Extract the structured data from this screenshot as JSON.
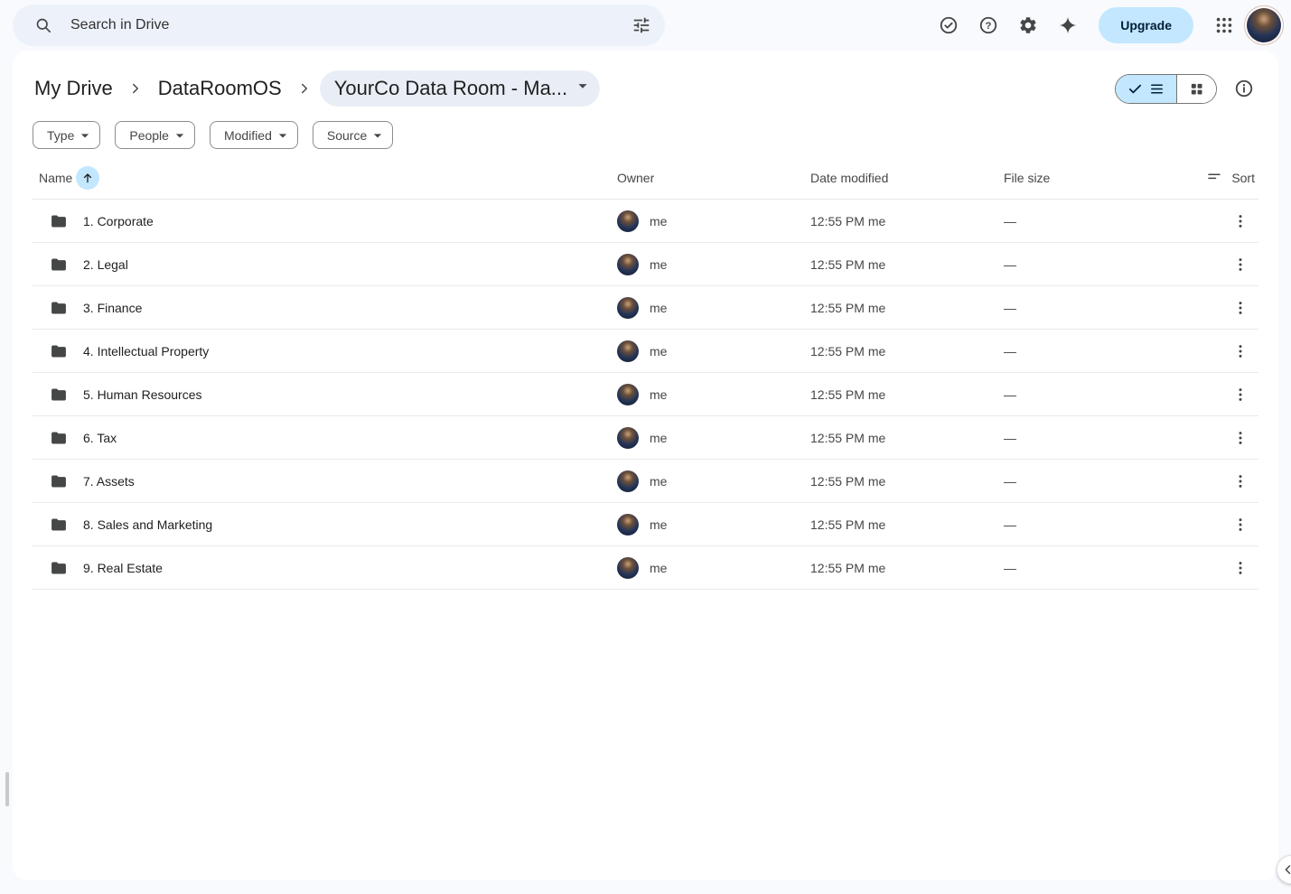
{
  "topbar": {
    "search_placeholder": "Search in Drive",
    "upgrade_label": "Upgrade"
  },
  "breadcrumb": {
    "items": [
      "My Drive",
      "DataRoomOS",
      "YourCo Data Room - Ma..."
    ]
  },
  "filters": [
    "Type",
    "People",
    "Modified",
    "Source"
  ],
  "table": {
    "headers": {
      "name": "Name",
      "owner": "Owner",
      "modified": "Date modified",
      "size": "File size",
      "sort": "Sort"
    },
    "rows": [
      {
        "name": "1. Corporate",
        "owner": "me",
        "modified": "12:55 PM me",
        "size": "—"
      },
      {
        "name": "2. Legal",
        "owner": "me",
        "modified": "12:55 PM me",
        "size": "—"
      },
      {
        "name": "3. Finance",
        "owner": "me",
        "modified": "12:55 PM me",
        "size": "—"
      },
      {
        "name": "4. Intellectual Property",
        "owner": "me",
        "modified": "12:55 PM me",
        "size": "—"
      },
      {
        "name": "5. Human Resources",
        "owner": "me",
        "modified": "12:55 PM me",
        "size": "—"
      },
      {
        "name": "6. Tax",
        "owner": "me",
        "modified": "12:55 PM me",
        "size": "—"
      },
      {
        "name": "7. Assets",
        "owner": "me",
        "modified": "12:55 PM me",
        "size": "—"
      },
      {
        "name": "8. Sales and Marketing",
        "owner": "me",
        "modified": "12:55 PM me",
        "size": "—"
      },
      {
        "name": "9. Real Estate",
        "owner": "me",
        "modified": "12:55 PM me",
        "size": "—"
      }
    ]
  },
  "icons": {
    "search": "magnifier",
    "tune": "filter-sliders",
    "offline-status": "check-circle",
    "help": "question-circle",
    "settings": "gear",
    "gemini": "four-point-sparkle",
    "apps": "3x3-dot-grid",
    "list-view": "check + list lines",
    "grid-view": "2x2 squares",
    "info": "i-circle",
    "name-sort": "arrow-up in blue circle",
    "sort": "descending lines",
    "folder": "filled folder",
    "row-menu": "vertical 3 dots",
    "side-peek": "chevron-left"
  },
  "colors": {
    "chrome_bg": "#f8fafd",
    "surface": "#ffffff",
    "search_bg": "#edf2fa",
    "accent_blue": "#c2e7ff",
    "accent_text": "#001d35",
    "crumb_pill_bg": "#e9eef6",
    "divider": "#e7eaee",
    "text_primary": "#1f1f1f",
    "text_secondary": "#444746"
  }
}
